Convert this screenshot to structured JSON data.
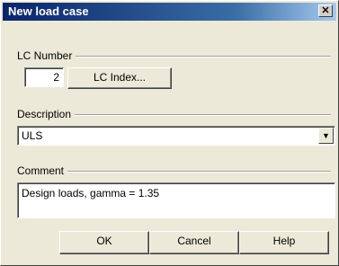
{
  "dialog": {
    "title": "New load case",
    "close_glyph": "✕"
  },
  "lc_number": {
    "label": "LC Number",
    "value": "2",
    "index_button": "LC Index..."
  },
  "description": {
    "label": "Description",
    "selected": "ULS",
    "arrow_icon": "chevron-down-icon"
  },
  "comment": {
    "label": "Comment",
    "value": "Design loads, gamma = 1.35"
  },
  "buttons": {
    "ok": "OK",
    "cancel": "Cancel",
    "help": "Help"
  }
}
